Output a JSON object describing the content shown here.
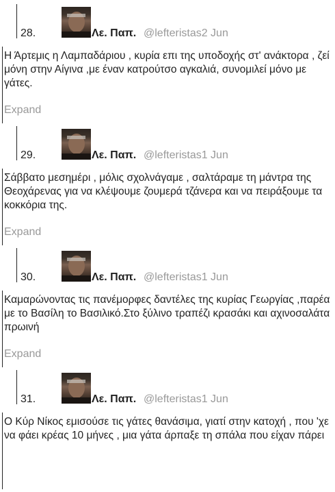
{
  "tweets": [
    {
      "number": "28.",
      "name": "Λε. Παπ.",
      "handle_date": "@lefteristas2 Jun",
      "text": "Η Άρτεμις η Λαμπαδάριου , κυρία επι της υποδοχής στ' ανάκτορα , ζεί μόνη στην Αίγινα ,με έναν κατρούτσο αγκαλιά, συνομιλεί μόνο με γάτες.",
      "expand": "Expand"
    },
    {
      "number": "29.",
      "name": "Λε. Παπ.",
      "handle_date": "@lefteristas1 Jun",
      "text": "Σάββατο μεσημέρι , μόλις σχολνάγαμε , σαλτάραμε τη μάντρα της Θεοχάρενας για να κλέψουμε ζουμερά τζάνερα και να πειράξουμε τα κοκκόρια της.",
      "expand": "Expand"
    },
    {
      "number": "30.",
      "name": "Λε. Παπ.",
      "handle_date": "@lefteristas1 Jun",
      "text": "Καμαρώνοντας τις πανέμορφες δαντέλες της κυρίας Γεωργίας ,παρέα με το Βασίλη το Βασιλικό.Στο ξύλινο τραπέζι κρασάκι και αχινοσαλάτα πρωινή",
      "expand": "Expand"
    },
    {
      "number": "31.",
      "name": "Λε. Παπ.",
      "handle_date": "@lefteristas1 Jun",
      "text": "Ο Κύρ Νίκος εμισούσε τις γάτες θανάσιμα, γιατί στην κατοχή , που 'χε να φάει κρέας 10 μήνες , μια γάτα άρπαξε τη σπάλα που είχαν πάρει",
      "expand": ""
    }
  ]
}
